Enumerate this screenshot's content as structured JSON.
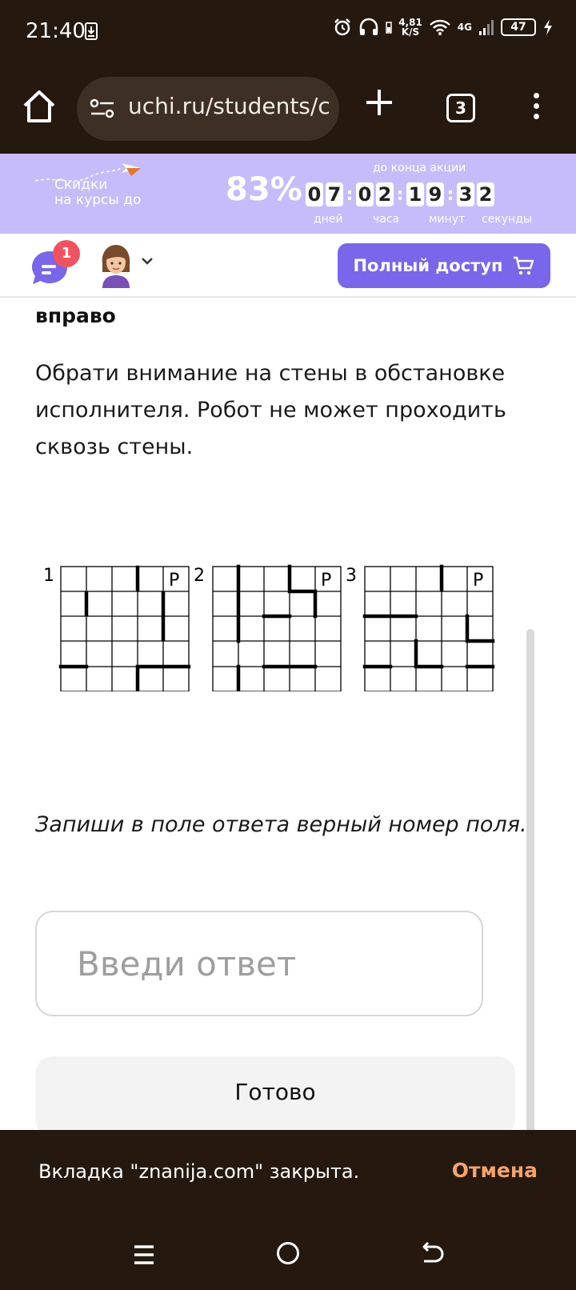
{
  "status_bar": {
    "time": "21:40",
    "speed_value": "4,81",
    "speed_unit": "K/S",
    "network": "4G",
    "battery": "47"
  },
  "browser": {
    "url": "uchi.ru/students/c",
    "tab_count": "3"
  },
  "promo": {
    "text_line1": "Скидки",
    "text_line2": "на курсы до",
    "percent": "83%",
    "until_label": "до конца акции",
    "timer": {
      "days": [
        "0",
        "7"
      ],
      "hours": [
        "0",
        "2"
      ],
      "minutes": [
        "1",
        "9"
      ],
      "seconds": [
        "3",
        "2"
      ]
    },
    "labels": {
      "days": "дней",
      "hours": "часа",
      "minutes": "минут",
      "seconds": "секунды"
    }
  },
  "header": {
    "chat_badge": "1",
    "full_access_label": "Полный доступ"
  },
  "content": {
    "heading_partial": "вправо",
    "instruction": "Обрати внимание на стены в обстановке исполнителя. Робот не может проходить сквозь стены.",
    "grids": [
      {
        "number": "1",
        "robot": "Р"
      },
      {
        "number": "2",
        "robot": "Р"
      },
      {
        "number": "3",
        "robot": "Р"
      }
    ],
    "task": "Запиши в поле ответа верный номер поля.",
    "answer_placeholder": "Введи ответ",
    "done_label": "Готово"
  },
  "snackbar": {
    "message": "Вкладка \"znanija.com\" закрыта.",
    "undo_label": "Отмена"
  },
  "colors": {
    "system_bar": "#24180f",
    "promo_bg": "#c7bcfb",
    "accent": "#7966ea",
    "badge": "#f2525e",
    "undo": "#f5a36a"
  }
}
